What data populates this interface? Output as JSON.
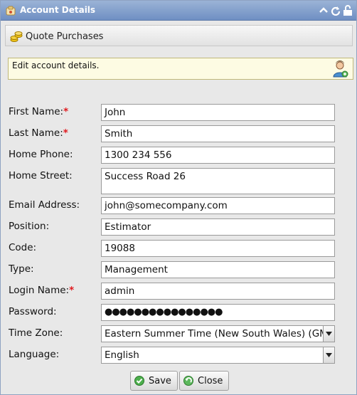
{
  "window": {
    "title": "Account Details",
    "title_buttons": [
      "chevron-up-icon",
      "refresh-icon",
      "unlock-icon"
    ]
  },
  "toolbar": {
    "quote_purchases_label": "Quote Purchases"
  },
  "info": {
    "text": "Edit account details."
  },
  "form": {
    "first_name": {
      "label": "First Name:",
      "required": true,
      "value": "John"
    },
    "last_name": {
      "label": "Last Name:",
      "required": true,
      "value": "Smith"
    },
    "home_phone": {
      "label": "Home Phone:",
      "value": "1300 234 556"
    },
    "home_street": {
      "label": "Home Street:",
      "value": "Success Road 26"
    },
    "email": {
      "label": "Email Address:",
      "value": "john@somecompany.com"
    },
    "position": {
      "label": "Position:",
      "value": "Estimator"
    },
    "code": {
      "label": "Code:",
      "value": "19088"
    },
    "type": {
      "label": "Type:",
      "value": "Management"
    },
    "login_name": {
      "label": "Login Name:",
      "required": true,
      "value": "admin"
    },
    "password": {
      "label": "Password:",
      "value": "●●●●●●●●●●●●●●●●"
    },
    "time_zone": {
      "label": "Time Zone:",
      "value": "Eastern Summer Time (New South Wales) (GM"
    },
    "language": {
      "label": "Language:",
      "value": "English"
    }
  },
  "buttons": {
    "save_label": "Save",
    "close_label": "Close"
  },
  "colors": {
    "titlebar": "#7f9ccb",
    "required_star": "#e0191e",
    "info_bg": "#fdfbe3",
    "window_bg": "#e8e8e8"
  }
}
